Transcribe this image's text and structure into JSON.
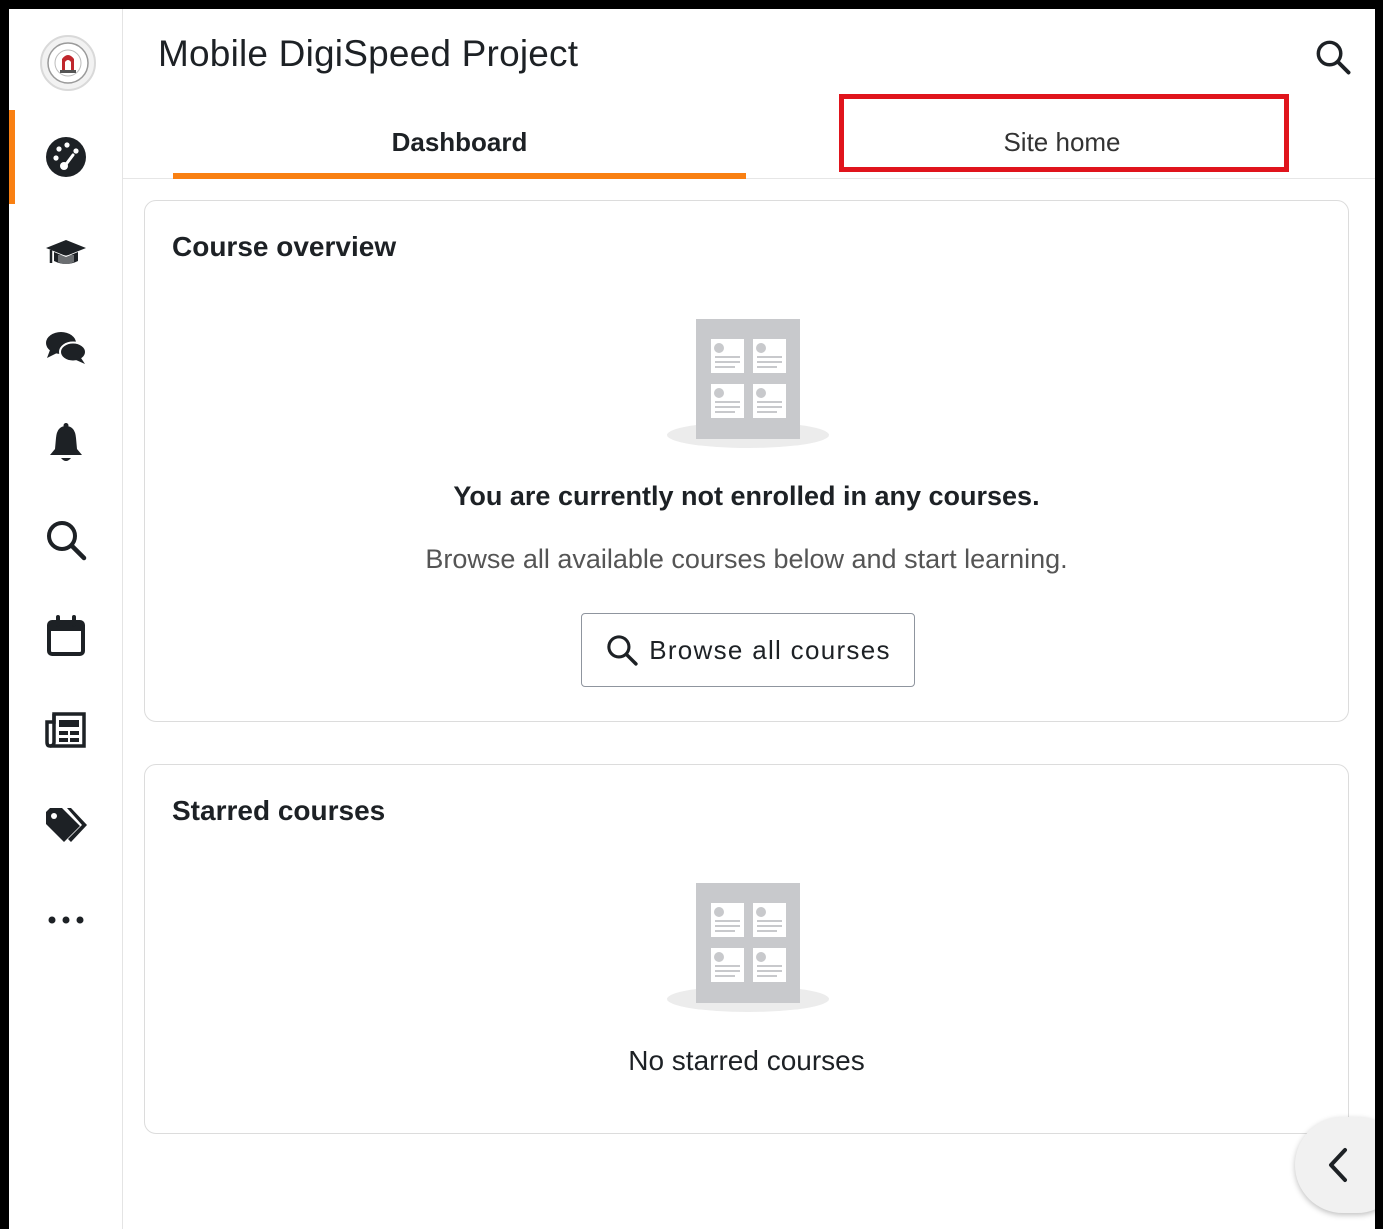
{
  "app": {
    "title": "Mobile DigiSpeed Project"
  },
  "colors": {
    "accent": "#f98012",
    "highlight": "#e0141c",
    "text": "#1d2125"
  },
  "sidebar": {
    "logo_icon": "university-seal-icon",
    "items": [
      {
        "name": "dashboard",
        "icon": "dashboard-gauge-icon",
        "active": true
      },
      {
        "name": "my-courses",
        "icon": "graduation-cap-icon",
        "active": false
      },
      {
        "name": "messages",
        "icon": "chat-bubbles-icon",
        "active": false
      },
      {
        "name": "notifications",
        "icon": "bell-icon",
        "active": false
      },
      {
        "name": "search",
        "icon": "search-icon",
        "active": false
      },
      {
        "name": "calendar",
        "icon": "calendar-icon",
        "active": false
      },
      {
        "name": "news",
        "icon": "newspaper-icon",
        "active": false
      },
      {
        "name": "tags",
        "icon": "tags-icon",
        "active": false
      },
      {
        "name": "more",
        "icon": "more-dots-icon",
        "active": false
      }
    ]
  },
  "tabs": [
    {
      "label": "Dashboard",
      "active": true
    },
    {
      "label": "Site home",
      "active": false
    }
  ],
  "course_overview": {
    "title": "Course overview",
    "empty_heading": "You are currently not enrolled in any courses.",
    "empty_subtext": "Browse all available courses below and start learning.",
    "browse_button": "Browse all courses"
  },
  "starred_courses": {
    "title": "Starred courses",
    "empty_text": "No starred courses"
  }
}
